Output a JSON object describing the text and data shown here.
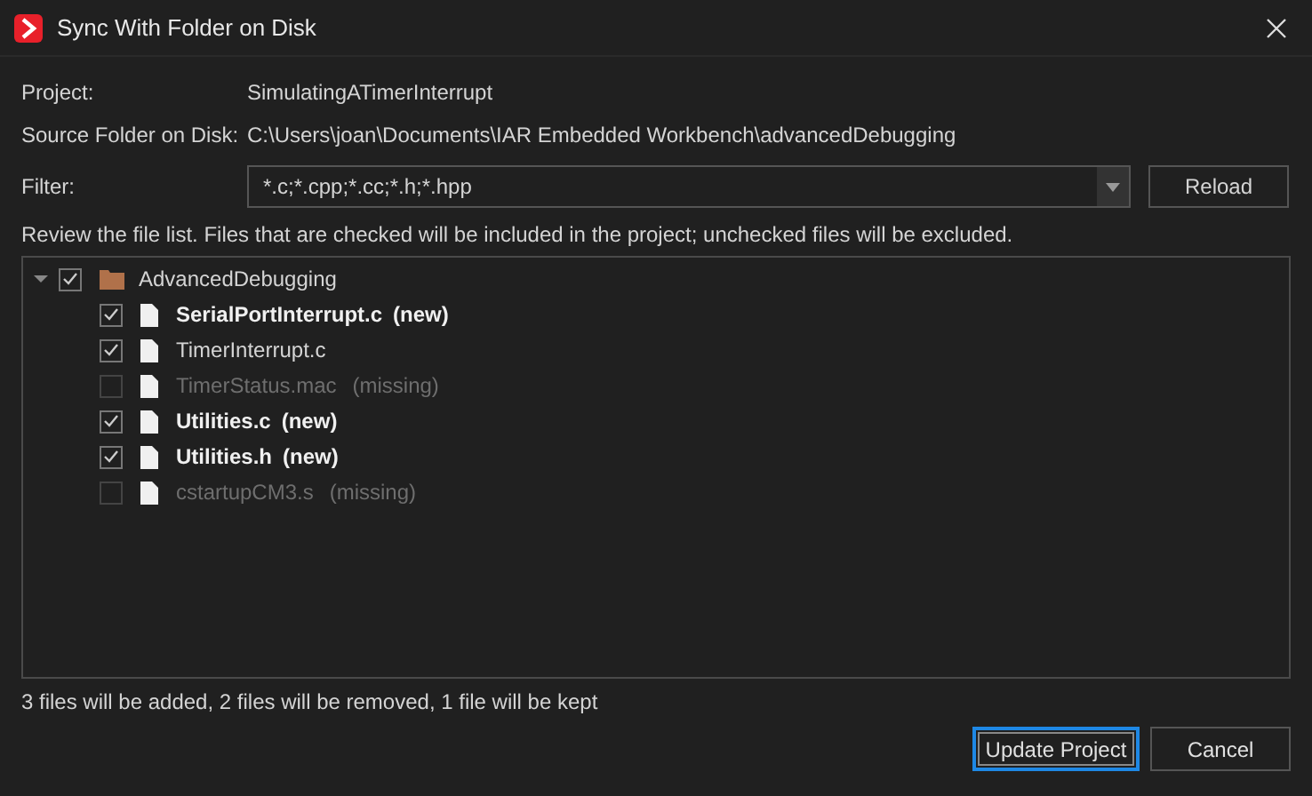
{
  "window": {
    "title": "Sync With Folder on Disk"
  },
  "project": {
    "label": "Project:",
    "value": "SimulatingATimerInterrupt"
  },
  "source_folder": {
    "label": "Source Folder on Disk:",
    "value": "C:\\Users\\joan\\Documents\\IAR Embedded Workbench\\advancedDebugging"
  },
  "filter": {
    "label": "Filter:",
    "value": "*.c;*.cpp;*.cc;*.h;*.hpp"
  },
  "reload_button": "Reload",
  "instructions": "Review the file list. Files that are checked will be included in the project; unchecked files will be excluded.",
  "tree": {
    "name": "AdvancedDebugging",
    "expanded": true,
    "checked": true,
    "children": [
      {
        "name": "SerialPortInterrupt.c",
        "note": "(new)",
        "kind": "new",
        "checked": true
      },
      {
        "name": "TimerInterrupt.c",
        "kind": "kept",
        "checked": true
      },
      {
        "name": "TimerStatus.mac",
        "note": "(missing)",
        "kind": "missing",
        "checked": false
      },
      {
        "name": "Utilities.c",
        "note": "(new)",
        "kind": "new",
        "checked": true
      },
      {
        "name": "Utilities.h",
        "note": "(new)",
        "kind": "new",
        "checked": true
      },
      {
        "name": "cstartupCM3.s",
        "note": "(missing)",
        "kind": "missing",
        "checked": false
      }
    ]
  },
  "summary": "3 files will be added, 2 files will be removed, 1 file will be kept",
  "buttons": [
    {
      "label": "Update Project",
      "selected": true
    },
    {
      "label": "Cancel",
      "selected": false
    }
  ]
}
